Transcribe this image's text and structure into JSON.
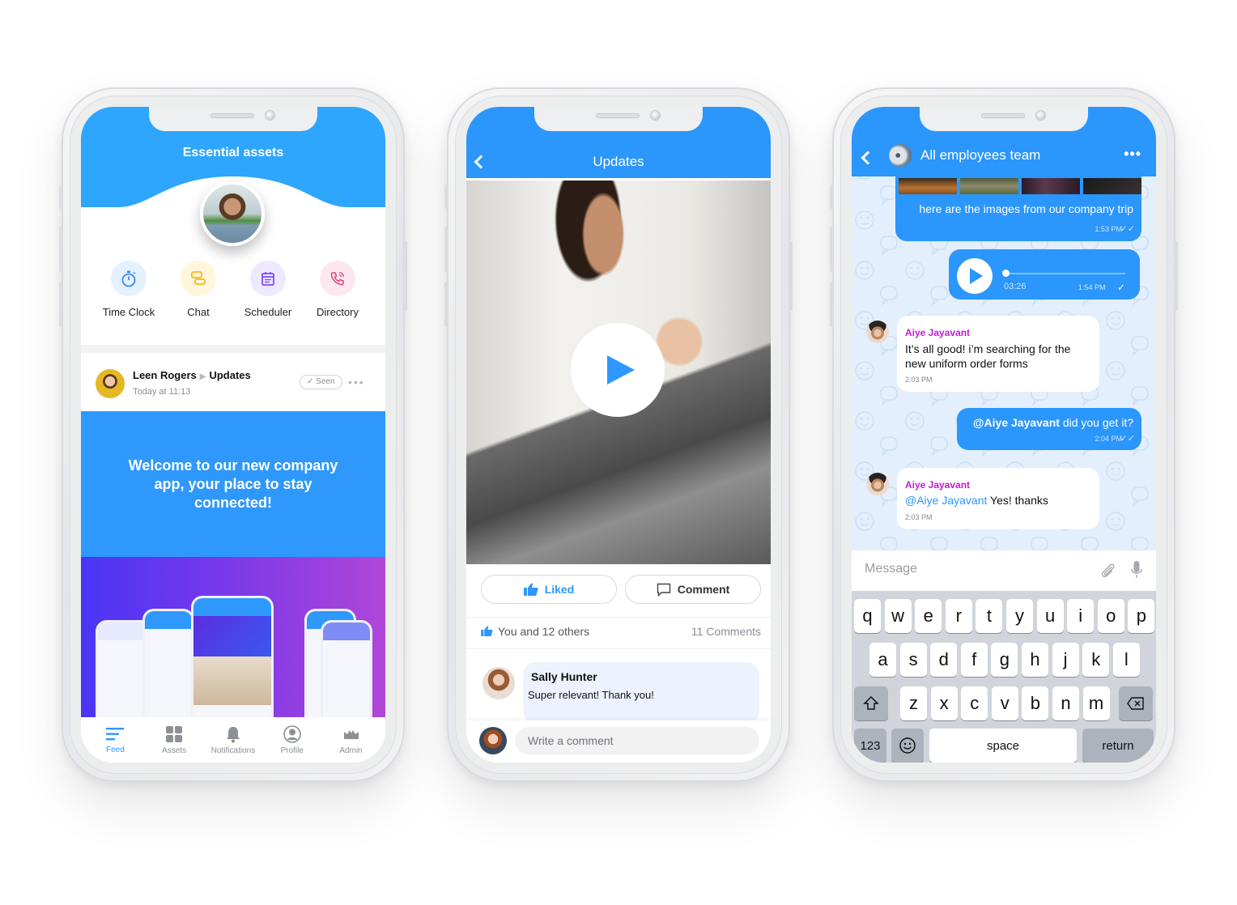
{
  "phone1": {
    "title": "Essential assets",
    "assets": [
      {
        "icon": "stopwatch-icon",
        "label": "Time Clock",
        "color": "#3b8cf6",
        "bg": "#e6f1ff"
      },
      {
        "icon": "chat-bubbles-icon",
        "label": "Chat",
        "color": "#f4b81e",
        "bg": "#fff6dc"
      },
      {
        "icon": "calendar-icon",
        "label": "Scheduler",
        "color": "#7a4cf0",
        "bg": "#efe9ff"
      },
      {
        "icon": "phone-call-icon",
        "label": "Directory",
        "color": "#e63f7a",
        "bg": "#fde8ef"
      }
    ],
    "post": {
      "author": "Leen Rogers",
      "channel": "Updates",
      "time": "Today at 11:13",
      "seen_label": "Seen",
      "banner_text": "Welcome to our new company app, your place to stay connected!"
    },
    "tabs": [
      {
        "icon": "feed-icon",
        "label": "Feed",
        "active": true
      },
      {
        "icon": "assets-grid-icon",
        "label": "Assets",
        "active": false
      },
      {
        "icon": "bell-icon",
        "label": "Notifications",
        "active": false
      },
      {
        "icon": "profile-icon",
        "label": "Profile",
        "active": false
      },
      {
        "icon": "crown-icon",
        "label": "Admin",
        "active": false
      }
    ]
  },
  "phone2": {
    "title": "Updates",
    "liked_label": "Liked",
    "comment_label": "Comment",
    "likes_text": "You and 12 others",
    "comments_count": "11 Comments",
    "comment": {
      "author": "Sally Hunter",
      "text": "Super relevant! Thank you!"
    },
    "compose_placeholder": "Write a comment"
  },
  "phone3": {
    "title": "All employees team",
    "messages": [
      {
        "type": "out",
        "text": "here are the images from our company trip",
        "time": "1:53 PM"
      },
      {
        "type": "voice",
        "duration": "03:26",
        "time": "1:54 PM"
      },
      {
        "type": "in",
        "sender": "Aiye Jayavant",
        "text": "It’s all good! i’m searching for the new uniform order forms",
        "time": "2:03 PM"
      },
      {
        "type": "out",
        "mention": "@Aiye Jayavant",
        "text": " did you get it?",
        "time": "2:04 PM"
      },
      {
        "type": "in",
        "sender": "Aiye Jayavant",
        "mention": "@Aiye Jayavant",
        "text": " Yes! thanks",
        "time": "2:03 PM"
      }
    ],
    "input_placeholder": "Message",
    "keyboard": {
      "row1": [
        "q",
        "w",
        "e",
        "r",
        "t",
        "y",
        "u",
        "i",
        "o",
        "p"
      ],
      "row2": [
        "a",
        "s",
        "d",
        "f",
        "g",
        "h",
        "j",
        "k",
        "l"
      ],
      "row3": [
        "z",
        "x",
        "c",
        "v",
        "b",
        "n",
        "m"
      ],
      "numbers_label": "123",
      "space_label": "space",
      "return_label": "return"
    }
  },
  "colors": {
    "brand_blue": "#2b96fc",
    "mention_purple": "#c21bd3"
  }
}
